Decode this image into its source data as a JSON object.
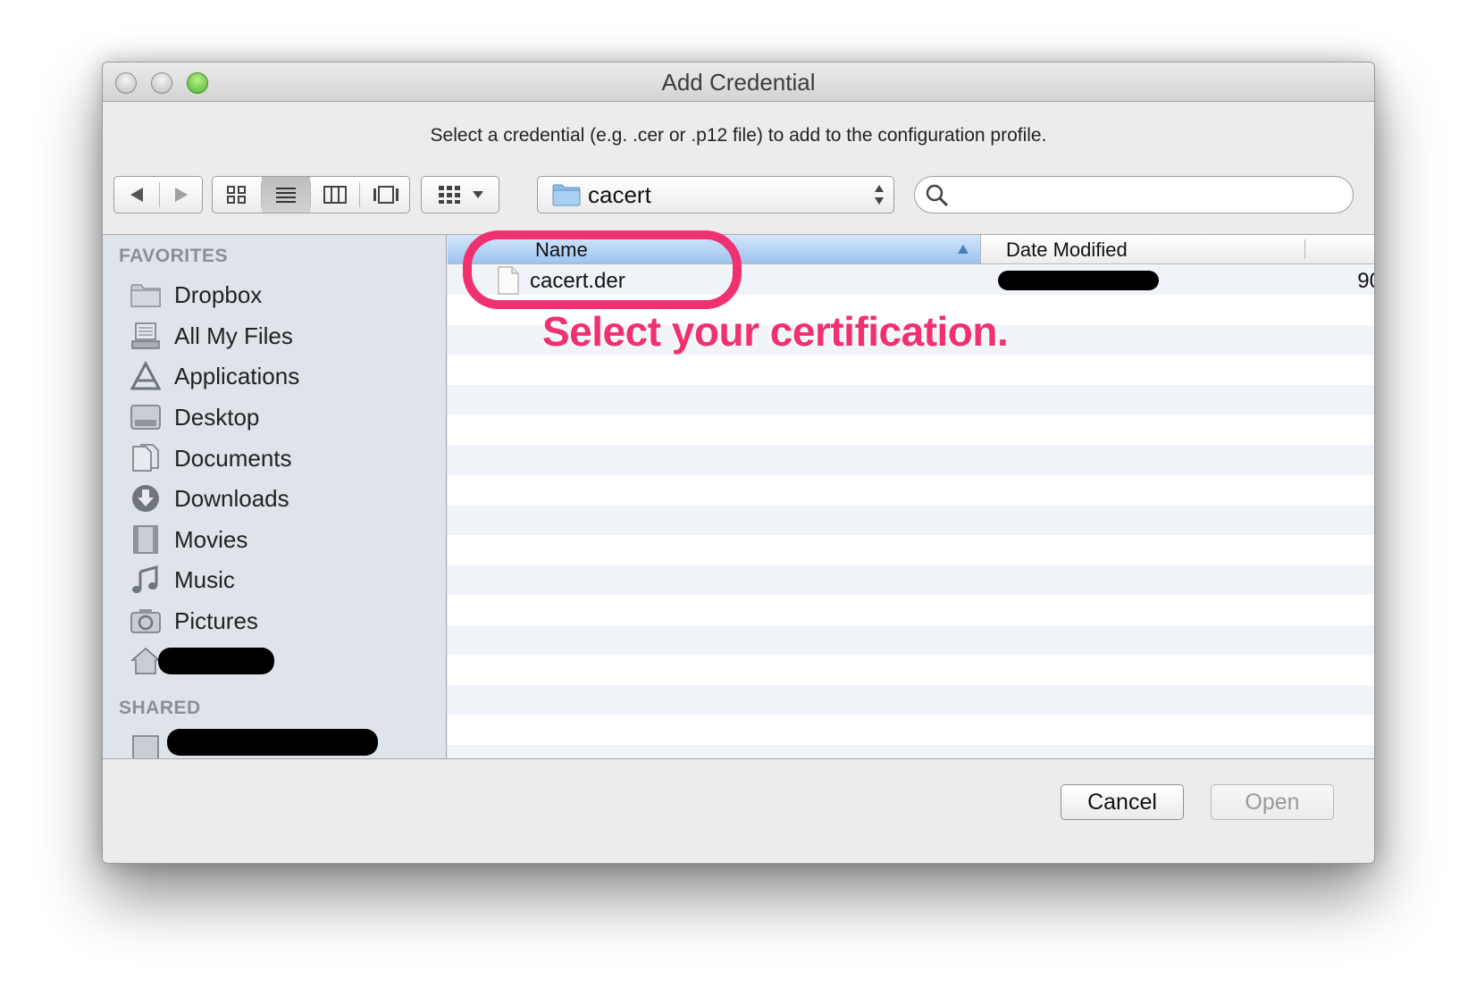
{
  "window": {
    "title": "Add Credential",
    "instruction": "Select a credential (e.g. .cer or .p12 file) to add to the configuration profile."
  },
  "toolbar": {
    "current_folder": "cacert",
    "search_placeholder": "",
    "view_mode_selected": "list"
  },
  "sidebar": {
    "favorites_label": "FAVORITES",
    "favorites": [
      {
        "label": "Dropbox",
        "icon": "folder-icon"
      },
      {
        "label": "All My Files",
        "icon": "all-files-icon"
      },
      {
        "label": "Applications",
        "icon": "applications-icon"
      },
      {
        "label": "Desktop",
        "icon": "desktop-icon"
      },
      {
        "label": "Documents",
        "icon": "documents-icon"
      },
      {
        "label": "Downloads",
        "icon": "downloads-icon"
      },
      {
        "label": "Movies",
        "icon": "movies-icon"
      },
      {
        "label": "Music",
        "icon": "music-icon"
      },
      {
        "label": "Pictures",
        "icon": "camera-icon"
      }
    ],
    "shared_label": "SHARED"
  },
  "file_list": {
    "columns": {
      "name": "Name",
      "date_modified": "Date Modified"
    },
    "files": [
      {
        "name": "cacert.der",
        "size_partial": "90"
      }
    ]
  },
  "buttons": {
    "cancel": "Cancel",
    "open": "Open"
  },
  "annotation": {
    "text": "Select your certification."
  },
  "colors": {
    "annotation": "#f0306f",
    "name_header": "#9cc3ef",
    "sidebar": "#dfe3ea"
  }
}
